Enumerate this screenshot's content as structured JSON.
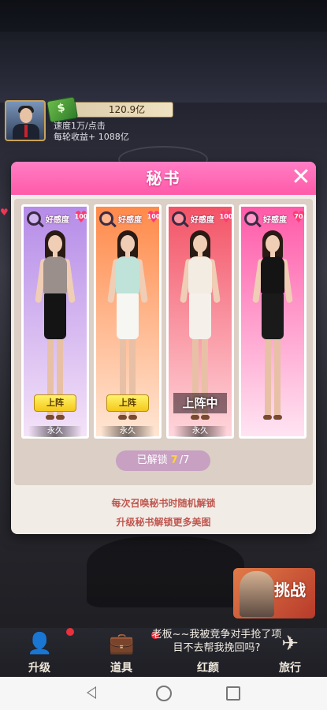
{
  "player": {
    "money": "120.9亿",
    "speed": "速度1万/点击",
    "income": "每轮收益+ 1088亿"
  },
  "modal": {
    "title": "秘书",
    "close_icon": "close-icon",
    "cards": [
      {
        "affinity_label": "好感度",
        "affinity_value": "100",
        "button_label": "上阵",
        "status": "available",
        "duration": "永久",
        "bg_top": "#b58ce8",
        "bg_bottom": "#f4e2f8",
        "top_color": "#9a8f8b",
        "skirt_color": "#141414"
      },
      {
        "affinity_label": "好感度",
        "affinity_value": "100",
        "button_label": "上阵",
        "status": "available",
        "duration": "永久",
        "bg_top": "#ff8a4a",
        "bg_bottom": "#ffe6d4",
        "top_color": "#bfe3d9",
        "skirt_color": "#f6f6f2"
      },
      {
        "affinity_label": "好感度",
        "affinity_value": "100",
        "button_label": "上阵中",
        "status": "deployed",
        "duration": "永久",
        "bg_top": "#f35366",
        "bg_bottom": "#ffd6dc",
        "top_color": "#f3ece2",
        "skirt_color": "#f5f0ea"
      },
      {
        "affinity_label": "好感度",
        "affinity_value": "70",
        "button_label": "",
        "status": "none",
        "duration": "",
        "bg_top": "#ff5aa8",
        "bg_bottom": "#ffe4f2",
        "top_color": "#141414",
        "skirt_color": "#1a1a1a"
      }
    ],
    "unlock": {
      "label": "已解锁",
      "current": "7",
      "total": "/7"
    },
    "hint1": "每次召唤秘书时随机解锁",
    "hint2": "升级秘书解锁更多美图"
  },
  "challenge": {
    "label": "挑战"
  },
  "speech": {
    "text": "老板~~我被竞争对手抢了项目不去帮我挽回吗?"
  },
  "bottom_nav": [
    {
      "label": "升级",
      "icon": "upgrade-person-icon"
    },
    {
      "label": "道具",
      "icon": "briefcase-icon"
    },
    {
      "label": "红颜",
      "icon": "woman-icon"
    },
    {
      "label": "旅行",
      "icon": "airplane-icon"
    }
  ]
}
